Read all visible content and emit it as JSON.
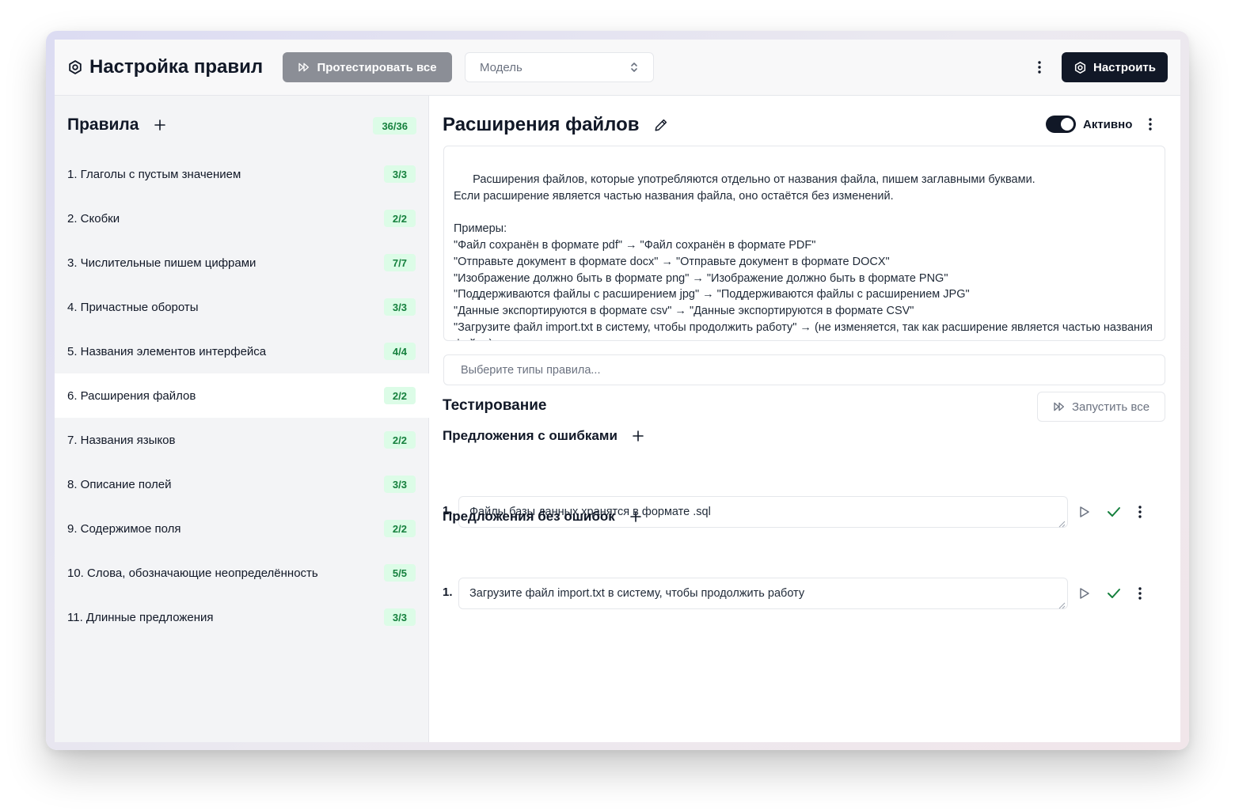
{
  "header": {
    "app_title": "Настройка правил",
    "test_all_label": "Протестировать все",
    "model_placeholder": "Модель",
    "configure_label": "Настроить"
  },
  "sidebar": {
    "title": "Правила",
    "total_badge": "36/36",
    "items": [
      {
        "label": "1. Глаголы с пустым значением",
        "badge": "3/3"
      },
      {
        "label": "2. Скобки",
        "badge": "2/2"
      },
      {
        "label": "3. Числительные пишем цифрами",
        "badge": "7/7"
      },
      {
        "label": "4. Причастные обороты",
        "badge": "3/3"
      },
      {
        "label": "5. Названия элементов интерфейса",
        "badge": "4/4"
      },
      {
        "label": "6. Расширения файлов",
        "badge": "2/2"
      },
      {
        "label": "7. Названия языков",
        "badge": "2/2"
      },
      {
        "label": "8. Описание полей",
        "badge": "3/3"
      },
      {
        "label": "9. Содержимое поля",
        "badge": "2/2"
      },
      {
        "label": "10. Слова, обозначающие неопределённость",
        "badge": "5/5"
      },
      {
        "label": "11. Длинные предложения",
        "badge": "3/3"
      }
    ],
    "active_index": 5
  },
  "rule": {
    "title": "Расширения файлов",
    "active_label": "Активно",
    "active": true,
    "description": "Расширения файлов, которые употребляются отдельно от названия файла, пишем заглавными буквами.\nЕсли расширение является частью названия файла, оно остаётся без изменений.\n\nПримеры:\n\"Файл сохранён в формате pdf\" → \"Файл сохранён в формате PDF\"\n\"Отправьте документ в формате docx\" → \"Отправьте документ в формате DOCX\"\n\"Изображение должно быть в формате png\" → \"Изображение должно быть в формате PNG\"\n\"Поддерживаются файлы с расширением jpg\" → \"Поддерживаются файлы с расширением JPG\"\n\"Данные экспортируются в формате csv\" → \"Данные экспортируются в формате CSV\"\n\"Загрузите файл import.txt в систему, чтобы продолжить работу\" → (не изменяется, так как расширение является частью названия файла)",
    "types_placeholder": "Выберите типы правила..."
  },
  "testing": {
    "title": "Тестирование",
    "run_all_label": "Запустить все",
    "with_errors_title": "Предложения с ошибками",
    "with_errors": [
      {
        "num": "1.",
        "text": "Файлы базы данных хранятся в формате .sql"
      }
    ],
    "without_errors_title": "Предложения без ошибок",
    "without_errors": [
      {
        "num": "1.",
        "text": "Загрузите файл import.txt в систему, чтобы продолжить работу"
      }
    ]
  },
  "colors": {
    "accent_dark": "#111827",
    "badge_bg": "#dcfce7",
    "badge_text": "#15803d",
    "check_green": "#15803d"
  }
}
